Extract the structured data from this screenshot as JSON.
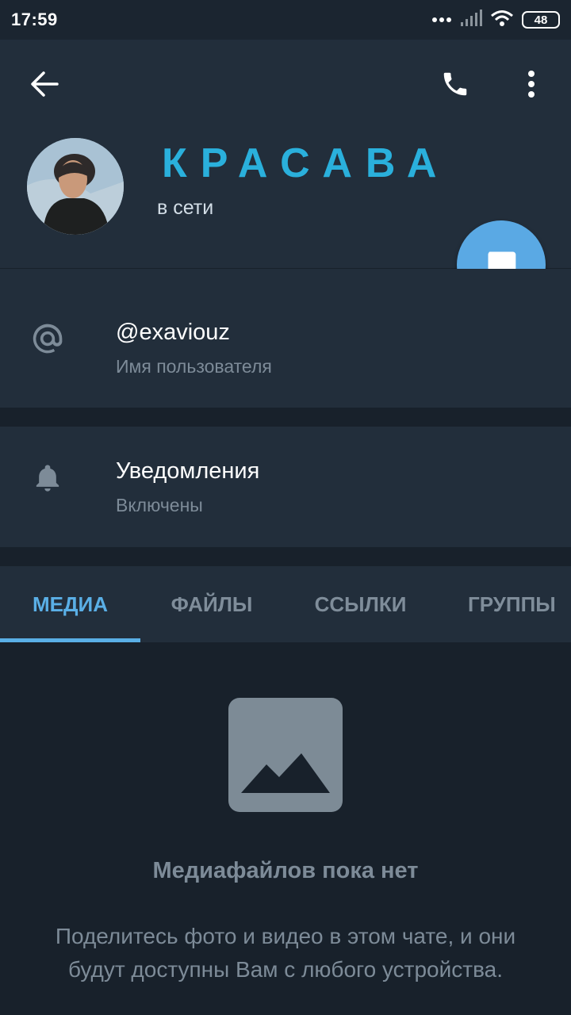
{
  "status_bar": {
    "time": "17:59",
    "battery": "48"
  },
  "header": {
    "back_icon": "arrow-left-icon",
    "call_icon": "phone-icon",
    "more_icon": "more-vertical-icon"
  },
  "profile": {
    "name": "КРАСАВА",
    "status": "в сети",
    "accent_color": "#2ab0dc"
  },
  "fab": {
    "icon": "message-icon",
    "color": "#5aa9e4"
  },
  "info": {
    "username": {
      "icon": "at-icon",
      "value": "@exaviouz",
      "label": "Имя пользователя"
    },
    "notifications": {
      "icon": "bell-icon",
      "title": "Уведомления",
      "value": "Включены"
    }
  },
  "tabs": {
    "items": [
      "МЕДИА",
      "ФАЙЛЫ",
      "ССЫЛКИ",
      "ГРУППЫ"
    ],
    "active": "МЕДИА"
  },
  "empty_state": {
    "icon": "image-placeholder-icon",
    "title": "Медиафайлов пока нет",
    "description_line1": "Поделитесь фото и видео в этом чате, и они",
    "description_line2": "будут доступны Вам с любого устройства."
  }
}
